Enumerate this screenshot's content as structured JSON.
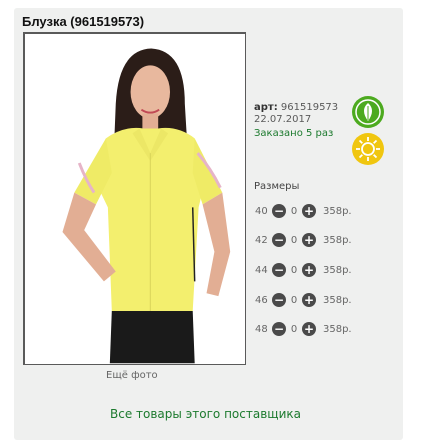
{
  "product": {
    "title": "Блузка (961519573)",
    "art_label": "арт:",
    "art_value": "961519573",
    "date": "22.07.2017",
    "ordered": "Заказано 5 раз"
  },
  "sizes_title": "Размеры",
  "sizes": [
    {
      "size": "40",
      "qty": "0",
      "price": "358р."
    },
    {
      "size": "42",
      "qty": "0",
      "price": "358р."
    },
    {
      "size": "44",
      "qty": "0",
      "price": "358р."
    },
    {
      "size": "46",
      "qty": "0",
      "price": "358р."
    },
    {
      "size": "48",
      "qty": "0",
      "price": "358р."
    }
  ],
  "controls": {
    "minus": "−",
    "plus": "+"
  },
  "links": {
    "more_photos": "Ещё фото",
    "supplier": "Все товары этого поставщика"
  },
  "colors": {
    "accent_green": "#1c7a2e",
    "leaf_badge": "#4caa1f",
    "sun_badge": "#f0c60f",
    "blouse": "#f3ef6e"
  },
  "icons": [
    "leaf-icon",
    "sun-icon",
    "minus-icon",
    "plus-icon"
  ]
}
